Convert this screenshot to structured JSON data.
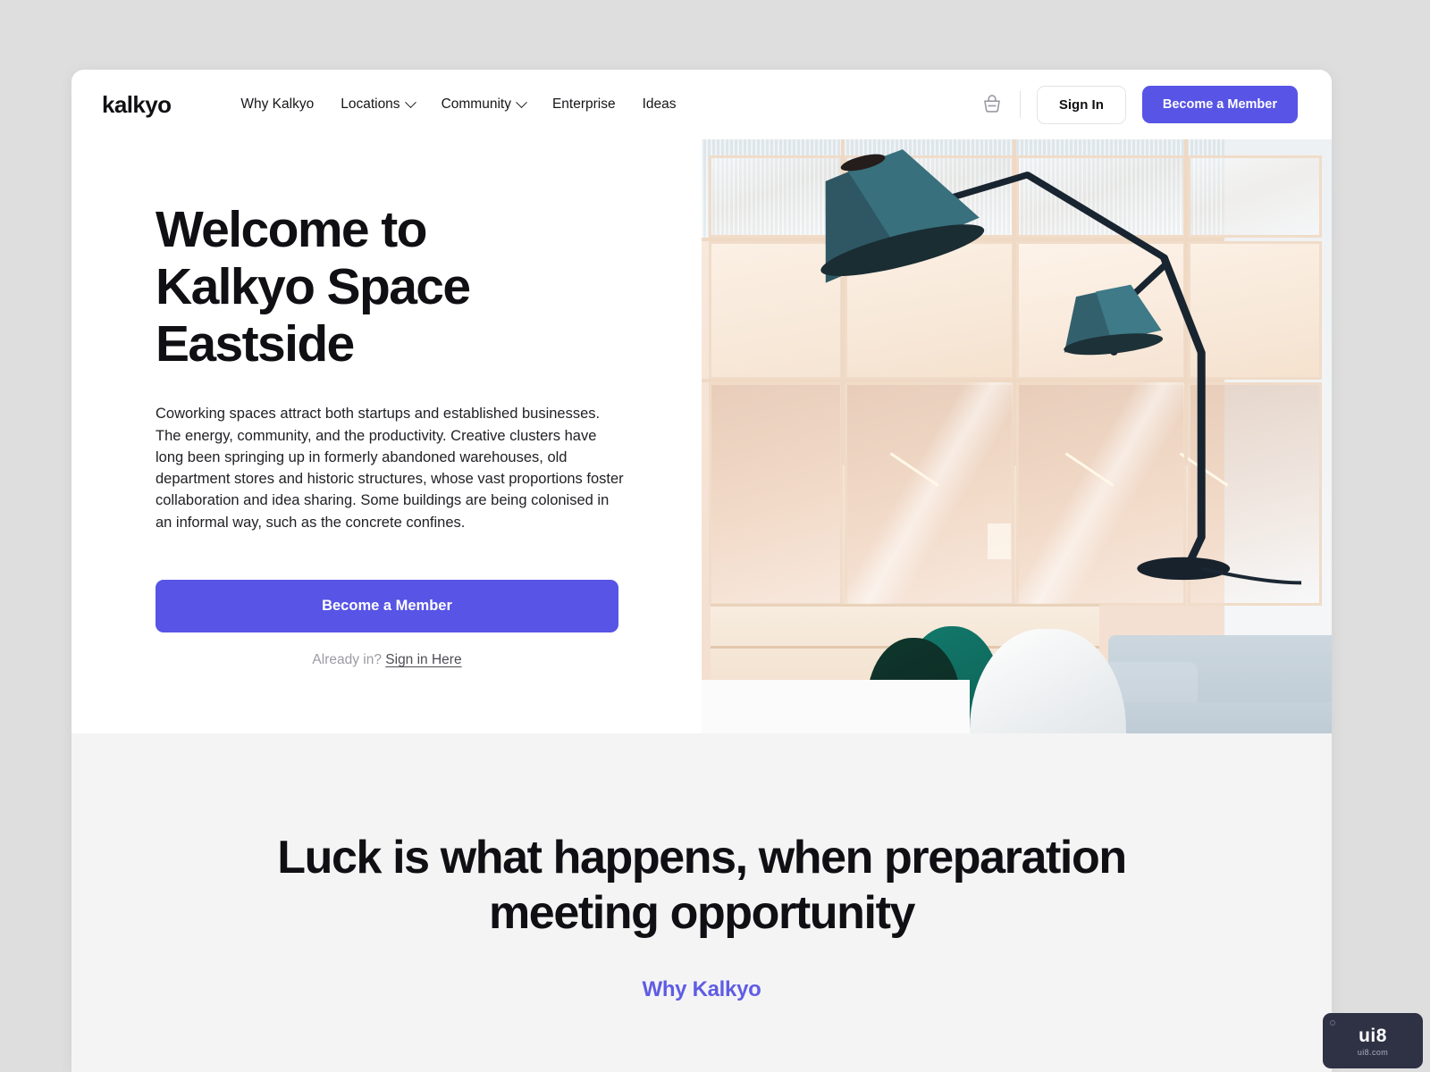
{
  "brand": {
    "name": "kalkyo"
  },
  "nav": {
    "items": [
      {
        "label": "Why Kalkyo",
        "has_caret": false
      },
      {
        "label": "Locations",
        "has_caret": true
      },
      {
        "label": "Community",
        "has_caret": true
      },
      {
        "label": "Enterprise",
        "has_caret": false
      },
      {
        "label": "Ideas",
        "has_caret": false
      }
    ]
  },
  "header_actions": {
    "basket_icon": "shopping-basket-icon",
    "sign_in_label": "Sign In",
    "become_member_label": "Become a Member"
  },
  "hero": {
    "title": "Welcome to Kalkyo Space Eastside",
    "body": "Coworking spaces attract both startups and established businesses. The energy, community, and the productivity. Creative clusters have long been springing up in formerly abandoned warehouses, old department stores and historic structures, whose vast proportions foster collaboration and idea sharing. Some buildings are being colonised in an informal way, such as the concrete confines.",
    "cta_label": "Become a Member",
    "already_prefix": "Already in? ",
    "already_link": "Sign in Here",
    "image_alt": "coworking-lounge-photo"
  },
  "quote": {
    "text": "Luck is what happens, when preparation meeting opportunity",
    "link_label": "Why Kalkyo"
  },
  "watermark": {
    "main": "ui8",
    "sub": "ui8.com"
  },
  "colors": {
    "accent": "#5754e6",
    "quote_link": "#5f5ce4",
    "page_bg": "#dedede",
    "section_bg": "#f4f4f5",
    "text": "#101014"
  }
}
